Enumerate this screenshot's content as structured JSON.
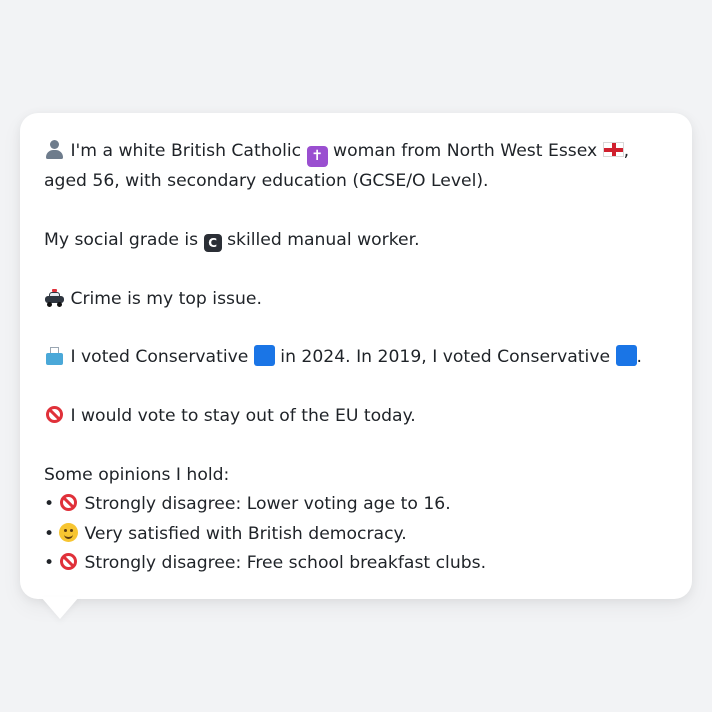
{
  "intro": {
    "t1": "I'm a white British Catholic",
    "t2": "woman from North West Essex",
    "t3": ", aged 56, with secondary education (GCSE/O Level)."
  },
  "social": {
    "t1": "My social grade is",
    "t2": "skilled manual worker.",
    "grade_letter": "C"
  },
  "issue": {
    "t1": "Crime is my top issue."
  },
  "vote": {
    "t1": "I voted Conservative",
    "t2": "in 2024. In 2019, I voted Conservative",
    "t3": "."
  },
  "eu": {
    "t1": "I would vote to stay out of the EU today."
  },
  "opinions": {
    "heading": "Some opinions I hold:",
    "bullet": "•",
    "items": [
      {
        "icon": "no-entry-icon",
        "text": "Strongly disagree: Lower voting age to 16."
      },
      {
        "icon": "smiling-face-icon",
        "text": "Very satisfied with British democracy."
      },
      {
        "icon": "no-entry-icon",
        "text": "Strongly disagree: Free school breakfast clubs."
      }
    ]
  },
  "icons": {
    "cross": "✝",
    "party_color": "#1a75e6",
    "no_entry_color": "#e0313a"
  }
}
